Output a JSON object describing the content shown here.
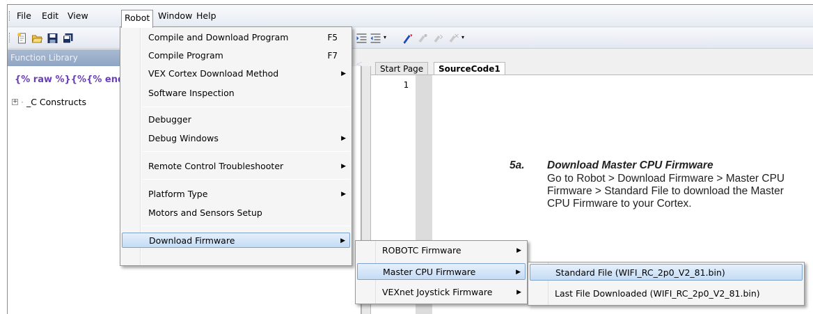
{
  "menubar": {
    "items": [
      "File",
      "Edit",
      "View",
      "Robot",
      "Window",
      "Help"
    ],
    "active": "Robot"
  },
  "toolbar": {
    "icons": [
      "new-file-icon",
      "open-folder-icon",
      "save-icon",
      "save-all-icon",
      "indent-icon",
      "outdent-icon",
      "dropdown-icon",
      "compile-icon",
      "bookmark-toggle-icon",
      "bookmark-next-icon",
      "bookmark-clear-icon"
    ]
  },
  "function_library": {
    "title": "Function Library",
    "tree": [
      {
        "label": "_C Constructs",
        "expander": "+"
      }
    ]
  },
  "editor": {
    "tabs": [
      "Start Page",
      "SourceCode1"
    ],
    "selected_tab": "SourceCode1",
    "line_numbers": [
      "1"
    ]
  },
  "robot_menu": {
    "items": [
      {
        "label": "Compile and Download Program",
        "shortcut": "F5"
      },
      {
        "label": "Compile Program",
        "shortcut": "F7"
      },
      {
        "label": "VEX Cortex Download Method",
        "submenu": true
      },
      {
        "label": "Software Inspection"
      },
      {
        "label": "Debugger"
      },
      {
        "label": "Debug Windows",
        "submenu": true
      },
      {
        "label": "Remote Control Troubleshooter",
        "submenu": true
      },
      {
        "label": "Platform Type",
        "submenu": true
      },
      {
        "label": "Motors and Sensors Setup"
      },
      {
        "label": "Download Firmware",
        "submenu": true,
        "highlighted": true
      }
    ]
  },
  "firmware_menu": {
    "items": [
      {
        "label": "ROBOTC Firmware",
        "submenu": true
      },
      {
        "label": "Master CPU Firmware",
        "submenu": true,
        "highlighted": true
      },
      {
        "label": "VEXnet Joystick Firmware",
        "submenu": true
      }
    ]
  },
  "master_cpu_menu": {
    "items": [
      {
        "label": "Standard File (WIFI_RC_2p0_V2_81.bin)",
        "highlighted": true
      },
      {
        "label": "Last File Downloaded (WIFI_RC_2p0_V2_81.bin)"
      }
    ]
  },
  "annotation": {
    "number": "5a.",
    "heading": "Download Master CPU Firmware",
    "body": "Go to Robot > Download Firmware > Master CPU Firmware > Standard File to download the Master CPU Firmware to your Cortex."
  },
  "colors": {
    "highlight_border": "#7da2ce",
    "panel_header": "#9aaecb",
    "menu_bg": "#f5f5f5"
  }
}
